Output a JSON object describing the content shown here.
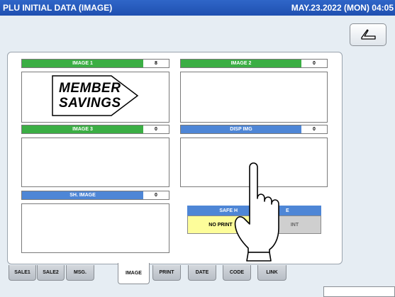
{
  "title_bar": {
    "title": "PLU INITIAL DATA (IMAGE)",
    "datetime": "MAY.23.2022 (MON) 04:05"
  },
  "back_button": {
    "icon": "return-arrow-icon"
  },
  "images": [
    {
      "label": "IMAGE 1",
      "value": "8",
      "color": "green"
    },
    {
      "label": "IMAGE 2",
      "value": "0",
      "color": "green"
    },
    {
      "label": "IMAGE 3",
      "value": "0",
      "color": "green"
    },
    {
      "label": "DISP IMG",
      "value": "0",
      "color": "blue"
    },
    {
      "label": "SH. IMAGE",
      "value": "0",
      "color": "blue"
    }
  ],
  "preview": {
    "line1": "MEMBER",
    "line2": "SAVINGS"
  },
  "safe_handling": {
    "label": "SAFE H",
    "label_tail": "E",
    "option_left": "NO PRINT",
    "option_right": "INT"
  },
  "tabs": [
    "SALE1",
    "SALE2",
    "MSG.",
    "IMAGE",
    "PRINT",
    "DATE",
    "CODE",
    "LINK"
  ],
  "active_tab": "IMAGE",
  "colors": {
    "green": "#3bae44",
    "blue": "#4e86d6",
    "title_bar": "#2358be",
    "yellow": "#fdfd9a"
  }
}
